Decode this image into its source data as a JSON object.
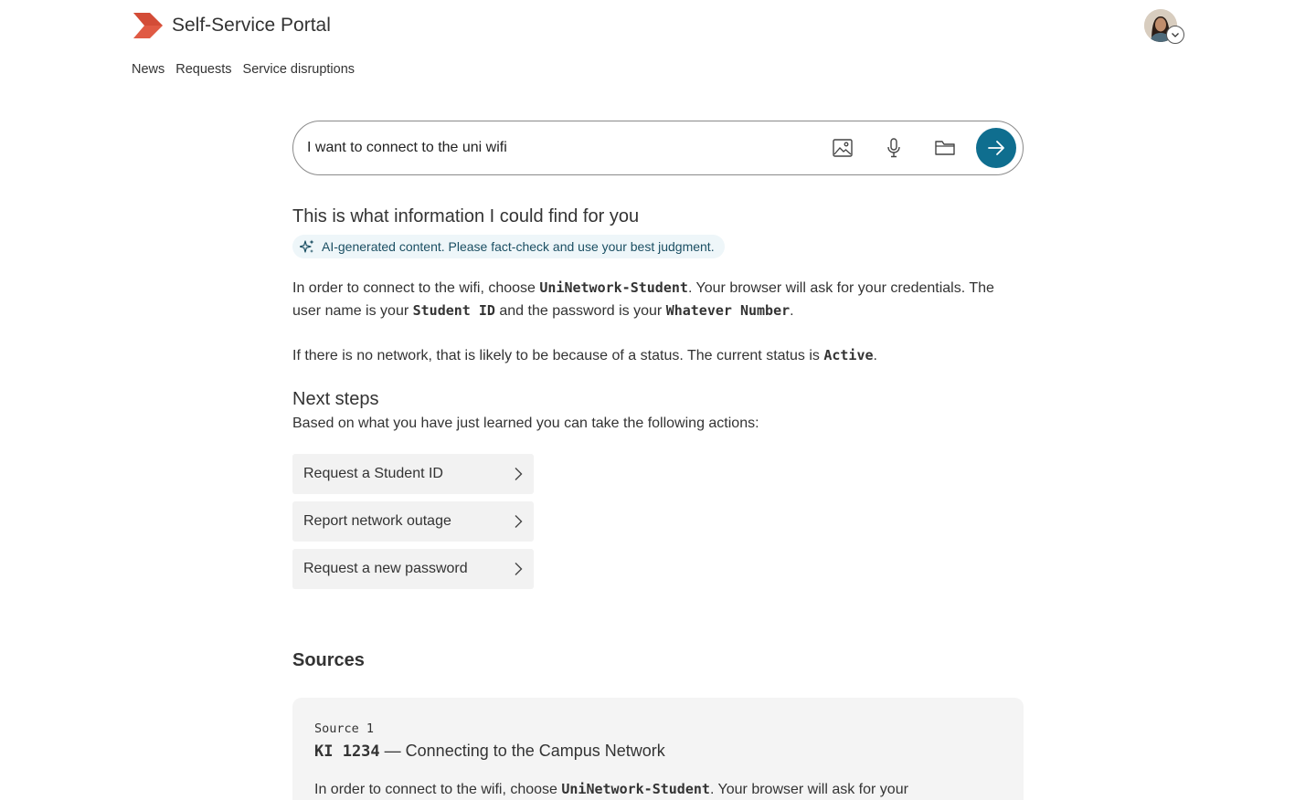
{
  "app": {
    "title": "Self-Service Portal",
    "brand_color": "#e05a44"
  },
  "user": {
    "avatar_icon": "user-avatar"
  },
  "nav": {
    "items": [
      {
        "label": "News"
      },
      {
        "label": "Requests"
      },
      {
        "label": "Service disruptions"
      }
    ]
  },
  "search": {
    "value": "I want to connect to the uni wifi",
    "buttons": {
      "image": "image-icon",
      "mic": "microphone-icon",
      "folder": "folder-icon",
      "send": "arrow-right-icon"
    },
    "accent": "#0f6e8f"
  },
  "result": {
    "title": "This is what information I could find for you",
    "ai_notice": "AI-generated content. Please fact-check and use your best judgment.",
    "p1": {
      "t1": "In order to connect to the wifi, choose ",
      "network": "UniNetwork-Student",
      "t2": ". Your browser will ask for your credentials. The user name is your ",
      "username": "Student ID",
      "t3": " and the password is your ",
      "password": "Whatever Number",
      "t4": "."
    },
    "p2": {
      "t1": "If there is no network, that is likely to be because of a status. The current status is ",
      "status": "Active",
      "t2": "."
    }
  },
  "next_steps": {
    "title": "Next steps",
    "intro": "Based on what you have just learned you can take the following actions:",
    "actions": [
      {
        "label": "Request a Student ID"
      },
      {
        "label": "Report network outage"
      },
      {
        "label": "Request a new password"
      }
    ]
  },
  "sources": {
    "title": "Sources",
    "items": [
      {
        "label": "Source 1",
        "id": "KI 1234",
        "title": " — Connecting to the Campus Network",
        "excerpt_t1": "In order to connect to the wifi, choose ",
        "excerpt_network": "UniNetwork-Student",
        "excerpt_t2": ". Your browser will ask for your"
      }
    ]
  }
}
